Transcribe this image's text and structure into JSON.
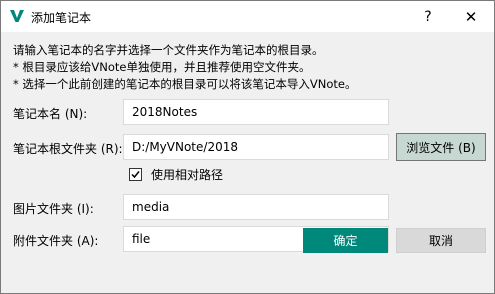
{
  "window": {
    "title": "添加笔记本",
    "help_glyph": "?",
    "close_glyph": "✕",
    "icon": "vnote-logo-icon",
    "accent_color": "#00897b"
  },
  "description": {
    "line1": "请输入笔记本的名字并选择一个文件夹作为笔记本的根目录。",
    "line2": "* 根目录应该给VNote单独使用，并且推荐使用空文件夹。",
    "line3": "* 选择一个此前创建的笔记本的根目录可以将该笔记本导入VNote。"
  },
  "form": {
    "name_label": "笔记本名 (N):",
    "name_value": "2018Notes",
    "root_label": "笔记本根文件夹 (R):",
    "root_value": "D:/MyVNote/2018",
    "browse_label": "浏览文件 (B)",
    "relative_label": "使用相对路径",
    "relative_checked": true,
    "image_label": "图片文件夹 (I):",
    "image_value": "media",
    "attach_label": "附件文件夹 (A):",
    "attach_value": "file"
  },
  "buttons": {
    "ok": "确定",
    "cancel": "取消"
  }
}
